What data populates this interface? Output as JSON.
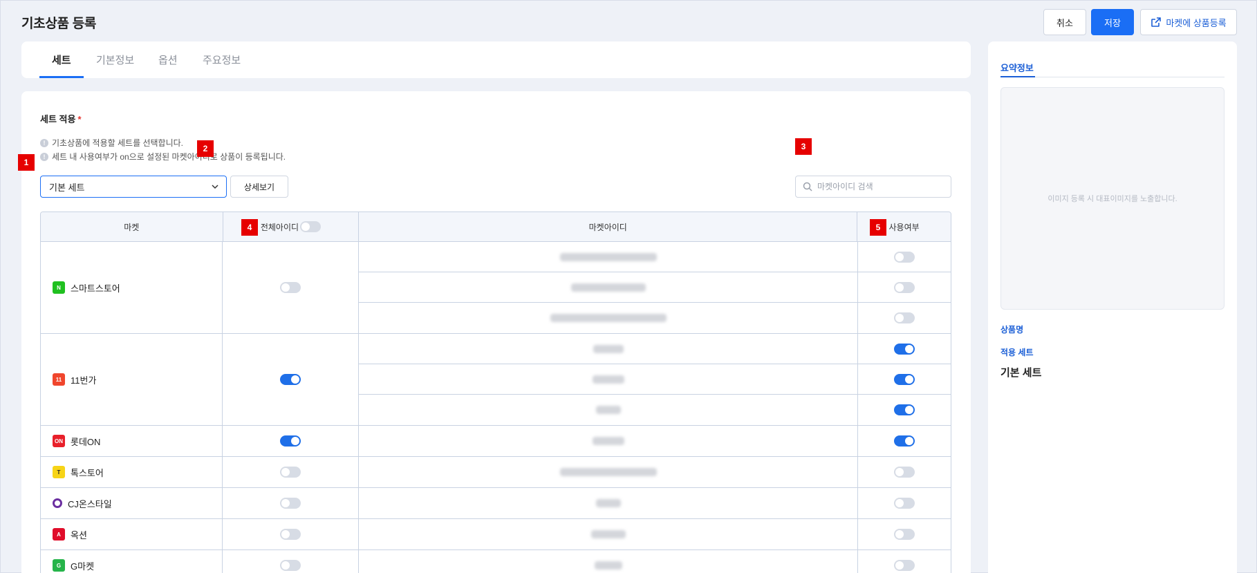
{
  "page_title": "기초상품 등록",
  "header_buttons": {
    "cancel": "취소",
    "save": "저장",
    "market_register": "마켓에 상품등록"
  },
  "tabs": [
    {
      "label": "세트",
      "active": true
    },
    {
      "label": "기본정보",
      "active": false
    },
    {
      "label": "옵션",
      "active": false
    },
    {
      "label": "주요정보",
      "active": false
    }
  ],
  "section": {
    "title": "세트 적용",
    "required_mark": "*",
    "info": [
      "기초상품에 적용할 세트를 선택합니다.",
      "세트 내 사용여부가 on으로 설정된 마켓아이디로 상품이 등록됩니다."
    ]
  },
  "set_select": {
    "value": "기본 세트"
  },
  "detail_button": "상세보기",
  "search": {
    "placeholder": "마켓아이디 검색"
  },
  "badges": [
    "1",
    "2",
    "3",
    "4",
    "5"
  ],
  "table": {
    "headers": {
      "market": "마켓",
      "all_ids": "전체아이디",
      "market_id": "마켓아이디",
      "use": "사용여부"
    },
    "all_ids_header_toggle": false,
    "groups": [
      {
        "name": "스마트스토어",
        "logo_color": "#20c020",
        "logo_text": "N",
        "all_on": false,
        "rows": [
          {
            "id_width": 140,
            "use": false
          },
          {
            "id_width": 108,
            "use": false
          },
          {
            "id_width": 168,
            "use": false
          }
        ]
      },
      {
        "name": "11번가",
        "logo_color": "#f0462d",
        "logo_text": "11",
        "all_on": true,
        "rows": [
          {
            "id_width": 44,
            "use": true
          },
          {
            "id_width": 46,
            "use": true
          },
          {
            "id_width": 36,
            "use": true
          }
        ]
      },
      {
        "name": "롯데ON",
        "logo_color": "#e8202a",
        "logo_text": "ON",
        "all_on": true,
        "rows": [
          {
            "id_width": 46,
            "use": true
          }
        ]
      },
      {
        "name": "톡스토어",
        "logo_color": "#f7d417",
        "logo_text": "T",
        "all_on": false,
        "rows": [
          {
            "id_width": 140,
            "use": false
          }
        ]
      },
      {
        "name": "CJ온스타일",
        "logo_color": "#6b2fa0",
        "logo_text": "O",
        "all_on": false,
        "rows": [
          {
            "id_width": 36,
            "use": false
          }
        ]
      },
      {
        "name": "옥션",
        "logo_color": "#e00d2a",
        "logo_text": "A",
        "all_on": false,
        "rows": [
          {
            "id_width": 50,
            "use": false
          }
        ]
      },
      {
        "name": "G마켓",
        "logo_color": "#26b44a",
        "logo_text": "G",
        "all_on": false,
        "rows": [
          {
            "id_width": 40,
            "use": false
          }
        ]
      }
    ]
  },
  "summary": {
    "tab": "요약정보",
    "image_placeholder": "이미지 등록 시 대표이미지를 노출합니다.",
    "product_name_label": "상품명",
    "applied_set_label": "적용 세트",
    "applied_set_value": "기본 세트"
  }
}
